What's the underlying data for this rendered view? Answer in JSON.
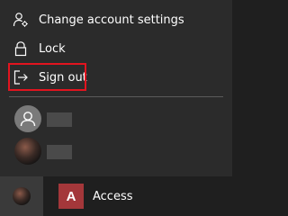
{
  "menu": {
    "items": [
      {
        "label": "Change account settings",
        "icon": "account-settings-icon"
      },
      {
        "label": "Lock",
        "icon": "lock-icon"
      },
      {
        "label": "Sign out",
        "icon": "sign-out-icon"
      }
    ],
    "highlighted_item": "Sign out",
    "highlight_color": "#e1141f"
  },
  "other_users": [
    {
      "avatar": "generic-user-avatar"
    },
    {
      "avatar": "photo-user-avatar"
    }
  ],
  "taskbar": {
    "current_user_avatar": "photo-user-avatar",
    "app": {
      "label": "Access",
      "icon_letter": "A",
      "icon_color": "#a4373a"
    }
  }
}
